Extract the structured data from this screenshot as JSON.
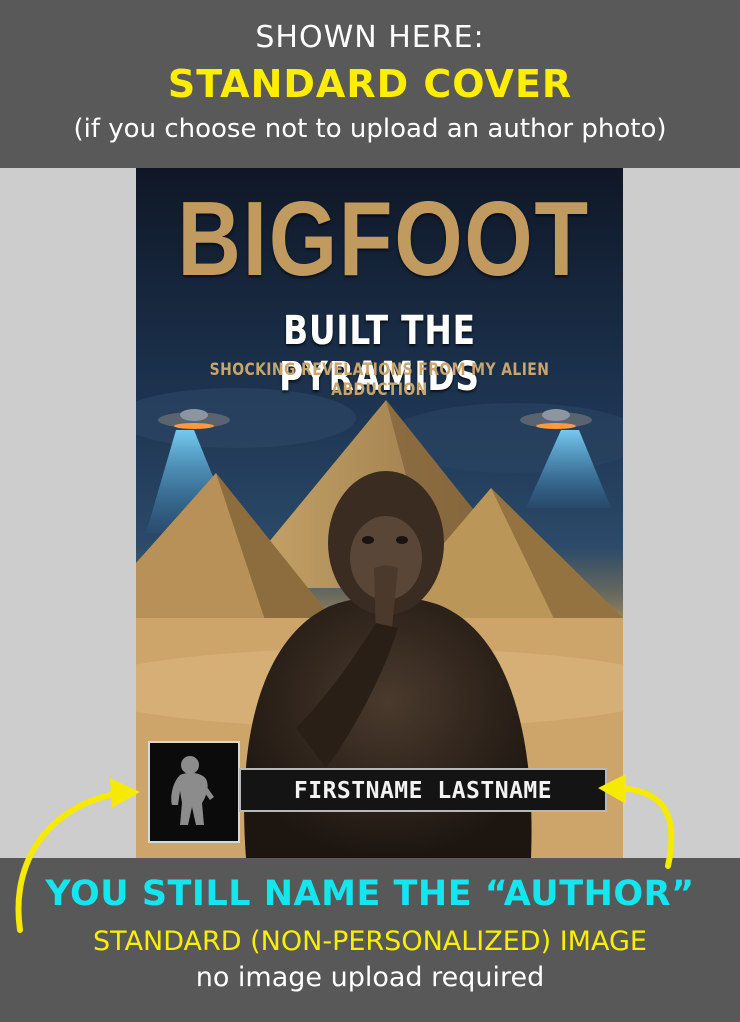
{
  "header": {
    "line1": "SHOWN HERE:",
    "line2": "STANDARD COVER",
    "line3": "(if you choose not to upload an author photo)"
  },
  "cover": {
    "title": "BIGFOOT",
    "subtitle": "BUILT THE PYRAMIDS",
    "tagline": "SHOCKING REVELATIONS FROM MY ALIEN ABDUCTION",
    "author_name": "FIRSTNAME LASTNAME"
  },
  "footer": {
    "line1": "YOU STILL NAME THE “AUTHOR”",
    "line2": "STANDARD (NON-PERSONALIZED) IMAGE",
    "line3": "no image upload required"
  },
  "colors": {
    "banner_bg": "#595959",
    "page_bg": "#cdcdcd",
    "highlight_yellow": "#ffee00",
    "highlight_cyan": "#14e6f0",
    "title_gold": "#c19a60"
  }
}
